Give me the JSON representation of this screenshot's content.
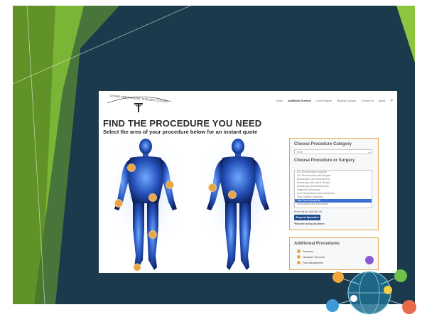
{
  "header": {
    "logo_alt": "Cedar Orthopaedic Surgery Center",
    "nav": [
      "Home",
      "Additional Services",
      "Cost Program",
      "Medical Courses",
      "Contact Us",
      "About"
    ]
  },
  "page": {
    "title": "FIND THE PROCEDURE YOU NEED",
    "subtitle": "Select the area of your procedure below for an instant quote"
  },
  "panel": {
    "category_heading": "Choose Procedure Category",
    "category_value": "Knee",
    "procedure_heading": "Choose Procedure or Surgery",
    "procedures": [
      "ACL Reconstruction autograft",
      "ACL Reconstruction with Allograft",
      "Arthroscopic Knee Synovectomy",
      "Arthroscopy with Lateral Release",
      "Arthroscopy with Meniscectomy",
      "Diagnostic Arthroscopy",
      "Knee Manipulation Under Anesthesia",
      "Tibial Tubercle Osteotomy",
      "Total Knee Arthroplasty",
      "Unicompartmental Arthroplasty"
    ],
    "selected_index": 8,
    "price_text": "Price will be: $16,800.00",
    "request_button": "Request Specialist",
    "disclaimer": "*Read the pricing disclaimer"
  },
  "additional": {
    "heading": "Additional Procedures",
    "items": [
      "Fractures",
      "Hardware Removal",
      "Pain Management"
    ]
  },
  "colors": {
    "slide_bg": "#1b3a4b",
    "accent_green": "#8cc63f",
    "orange": "#e8a64a",
    "button_blue": "#1f4d8e"
  }
}
